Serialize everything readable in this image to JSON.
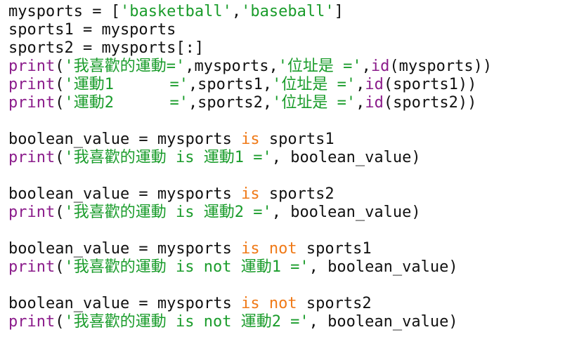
{
  "colors": {
    "background": "#ffffff",
    "text": "#111111",
    "builtin": "#8b1c8b",
    "string": "#1a9c2b",
    "keyword": "#f07a18"
  },
  "code": {
    "lines": [
      [
        {
          "t": "plain",
          "v": "mysports = ["
        },
        {
          "t": "str",
          "v": "'basketball'"
        },
        {
          "t": "plain",
          "v": ","
        },
        {
          "t": "str",
          "v": "'baseball'"
        },
        {
          "t": "plain",
          "v": "]"
        }
      ],
      [
        {
          "t": "plain",
          "v": "sports1 = mysports"
        }
      ],
      [
        {
          "t": "plain",
          "v": "sports2 = mysports[:]"
        }
      ],
      [
        {
          "t": "fn",
          "v": "print"
        },
        {
          "t": "plain",
          "v": "("
        },
        {
          "t": "str",
          "v": "'我喜歡的運動='"
        },
        {
          "t": "plain",
          "v": ",mysports,"
        },
        {
          "t": "str",
          "v": "'位址是 ='"
        },
        {
          "t": "plain",
          "v": ","
        },
        {
          "t": "fn",
          "v": "id"
        },
        {
          "t": "plain",
          "v": "(mysports))"
        }
      ],
      [
        {
          "t": "fn",
          "v": "print"
        },
        {
          "t": "plain",
          "v": "("
        },
        {
          "t": "str",
          "v": "'運動1      ='"
        },
        {
          "t": "plain",
          "v": ",sports1,"
        },
        {
          "t": "str",
          "v": "'位址是 ='"
        },
        {
          "t": "plain",
          "v": ","
        },
        {
          "t": "fn",
          "v": "id"
        },
        {
          "t": "plain",
          "v": "(sports1))"
        }
      ],
      [
        {
          "t": "fn",
          "v": "print"
        },
        {
          "t": "plain",
          "v": "("
        },
        {
          "t": "str",
          "v": "'運動2      ='"
        },
        {
          "t": "plain",
          "v": ",sports2,"
        },
        {
          "t": "str",
          "v": "'位址是 ='"
        },
        {
          "t": "plain",
          "v": ","
        },
        {
          "t": "fn",
          "v": "id"
        },
        {
          "t": "plain",
          "v": "(sports2))"
        }
      ],
      [],
      [
        {
          "t": "plain",
          "v": "boolean_value = mysports "
        },
        {
          "t": "kw",
          "v": "is"
        },
        {
          "t": "plain",
          "v": " sports1"
        }
      ],
      [
        {
          "t": "fn",
          "v": "print"
        },
        {
          "t": "plain",
          "v": "("
        },
        {
          "t": "str",
          "v": "'我喜歡的運動 is 運動1 ='"
        },
        {
          "t": "plain",
          "v": ", boolean_value)"
        }
      ],
      [],
      [
        {
          "t": "plain",
          "v": "boolean_value = mysports "
        },
        {
          "t": "kw",
          "v": "is"
        },
        {
          "t": "plain",
          "v": " sports2"
        }
      ],
      [
        {
          "t": "fn",
          "v": "print"
        },
        {
          "t": "plain",
          "v": "("
        },
        {
          "t": "str",
          "v": "'我喜歡的運動 is 運動2 ='"
        },
        {
          "t": "plain",
          "v": ", boolean_value)"
        }
      ],
      [],
      [
        {
          "t": "plain",
          "v": "boolean_value = mysports "
        },
        {
          "t": "kw",
          "v": "is"
        },
        {
          "t": "plain",
          "v": " "
        },
        {
          "t": "kw",
          "v": "not"
        },
        {
          "t": "plain",
          "v": " sports1"
        }
      ],
      [
        {
          "t": "fn",
          "v": "print"
        },
        {
          "t": "plain",
          "v": "("
        },
        {
          "t": "str",
          "v": "'我喜歡的運動 is not 運動1 ='"
        },
        {
          "t": "plain",
          "v": ", boolean_value)"
        }
      ],
      [],
      [
        {
          "t": "plain",
          "v": "boolean_value = mysports "
        },
        {
          "t": "kw",
          "v": "is"
        },
        {
          "t": "plain",
          "v": " "
        },
        {
          "t": "kw",
          "v": "not"
        },
        {
          "t": "plain",
          "v": " sports2"
        }
      ],
      [
        {
          "t": "fn",
          "v": "print"
        },
        {
          "t": "plain",
          "v": "("
        },
        {
          "t": "str",
          "v": "'我喜歡的運動 is not 運動2 ='"
        },
        {
          "t": "plain",
          "v": ", boolean_value)"
        }
      ]
    ]
  }
}
